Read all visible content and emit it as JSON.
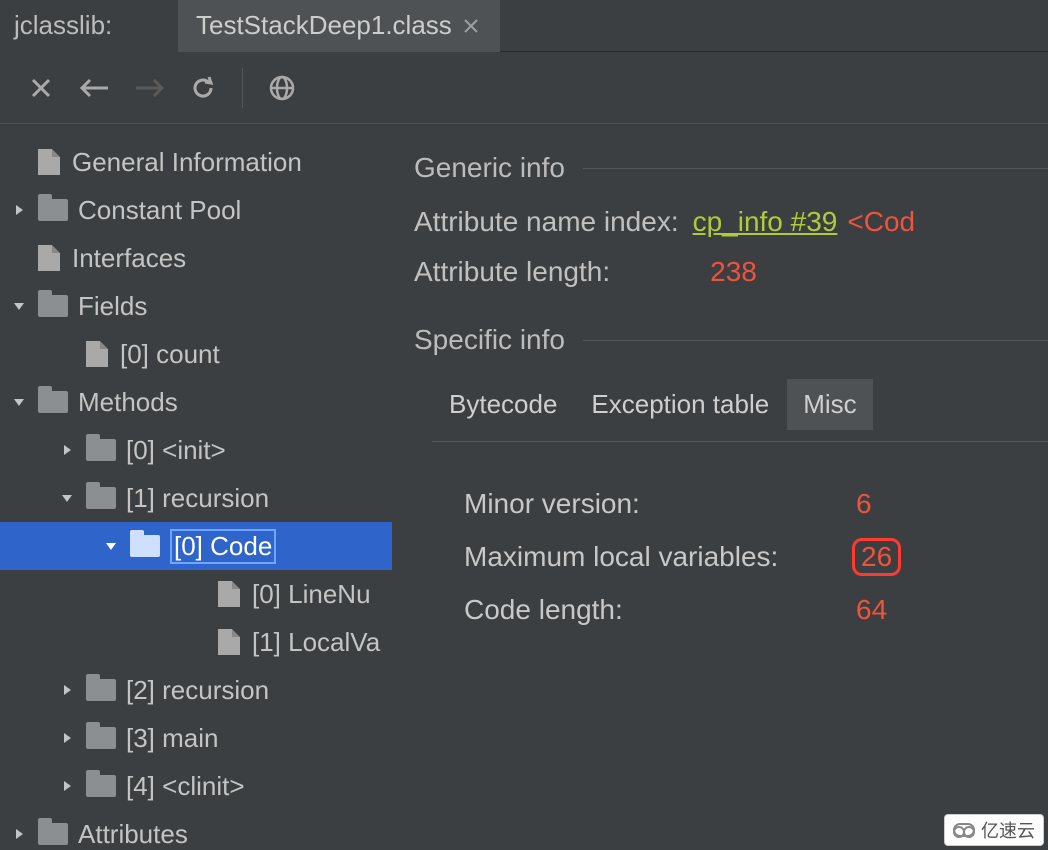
{
  "app_title": "jclasslib:",
  "tab": {
    "label": "TestStackDeep1.class"
  },
  "tree": {
    "items": [
      {
        "label": "General Information",
        "type": "file",
        "depth": 0,
        "disclosure": null
      },
      {
        "label": "Constant Pool",
        "type": "folder",
        "depth": 0,
        "disclosure": "closed"
      },
      {
        "label": "Interfaces",
        "type": "file",
        "depth": 0,
        "disclosure": null
      },
      {
        "label": "Fields",
        "type": "folder",
        "depth": 0,
        "disclosure": "open"
      },
      {
        "label": "[0] count",
        "type": "file",
        "depth": 1,
        "disclosure": null
      },
      {
        "label": "Methods",
        "type": "folder",
        "depth": 0,
        "disclosure": "open"
      },
      {
        "label": "[0] <init>",
        "type": "folder",
        "depth": 1,
        "disclosure": "closed"
      },
      {
        "label": "[1] recursion",
        "type": "folder",
        "depth": 1,
        "disclosure": "open"
      },
      {
        "label": "[0] Code",
        "type": "folder",
        "depth": 2,
        "disclosure": "open",
        "selected": true
      },
      {
        "label": "[0] LineNu",
        "type": "file",
        "depth": 3,
        "disclosure": null
      },
      {
        "label": "[1] LocalVa",
        "type": "file",
        "depth": 3,
        "disclosure": null
      },
      {
        "label": "[2] recursion",
        "type": "folder",
        "depth": 1,
        "disclosure": "closed"
      },
      {
        "label": "[3] main",
        "type": "folder",
        "depth": 1,
        "disclosure": "closed"
      },
      {
        "label": "[4] <clinit>",
        "type": "folder",
        "depth": 1,
        "disclosure": "closed"
      },
      {
        "label": "Attributes",
        "type": "folder",
        "depth": 0,
        "disclosure": "closed"
      }
    ]
  },
  "detail": {
    "generic_header": "Generic info",
    "attribute_name_index_label": "Attribute name index:",
    "attribute_name_index_link": "cp_info #39",
    "attribute_name_index_tag": "<Cod",
    "attribute_length_label": "Attribute length:",
    "attribute_length_value": "238",
    "specific_header": "Specific info",
    "tabs": [
      "Bytecode",
      "Exception table",
      "Misc"
    ],
    "active_tab": "Misc",
    "misc": {
      "minor_version_label": "Minor version:",
      "minor_version_value": "6",
      "max_local_label": "Maximum local variables:",
      "max_local_value": "26",
      "code_length_label": "Code length:",
      "code_length_value": "64"
    }
  },
  "watermark": "亿速云"
}
